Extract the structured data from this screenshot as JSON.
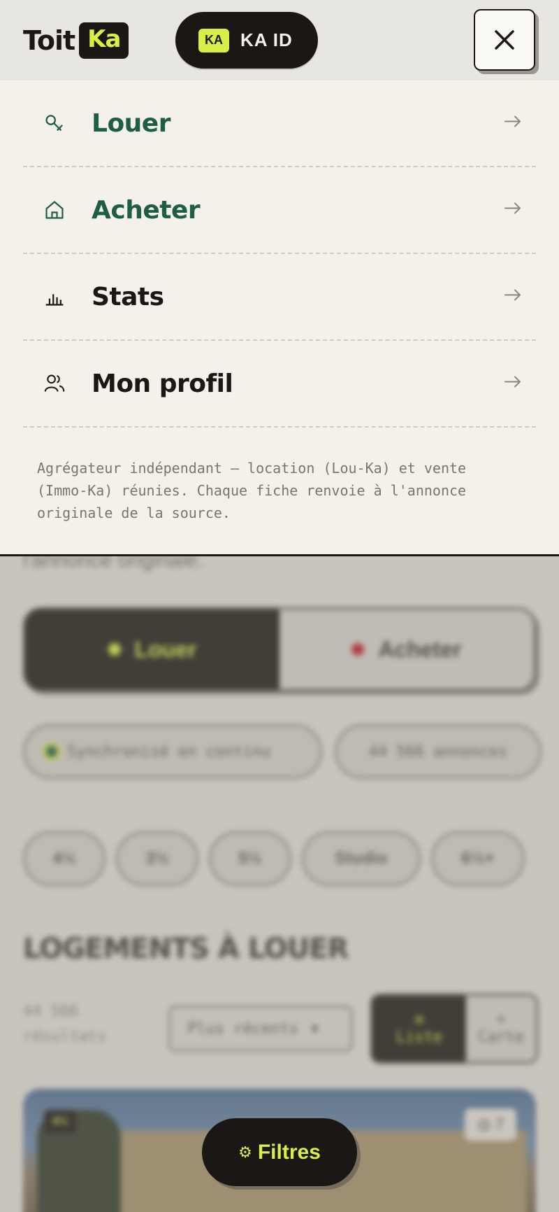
{
  "header": {
    "logo_text": "Toit",
    "logo_badge": "Ka",
    "kaid_badge": "KA",
    "kaid_label": "KA ID",
    "close_icon": "close-icon"
  },
  "menu": {
    "items": [
      {
        "label": "Louer",
        "icon": "key-icon",
        "color": "#1f5e44"
      },
      {
        "label": "Acheter",
        "icon": "house-icon",
        "color": "#1f5e44"
      },
      {
        "label": "Stats",
        "icon": "bar-chart-icon",
        "color": "#1a1714"
      },
      {
        "label": "Mon profil",
        "icon": "users-icon",
        "color": "#1a1714"
      }
    ],
    "note": "Agrégateur indépendant — location (Lou-Ka) et vente (Immo-Ka) réunies. Chaque fiche renvoie à l'annonce originale de la source."
  },
  "background": {
    "fragment": "l'annonce originale.",
    "toggle": {
      "louer": "Louer",
      "acheter": "Acheter"
    },
    "sync_status": "Synchronisé en continu",
    "listing_count": "44 566 annonces",
    "chips": [
      "4½",
      "3½",
      "5½",
      "Studio",
      "6½+"
    ],
    "section_title": "LOGEMENTS À LOUER",
    "results": "44 566 résultats",
    "sort_label": "Plus récents",
    "view_liste": "Liste",
    "view_carte": "Carte",
    "card_badge": "4½",
    "card_photos": "7"
  },
  "filters_button": "Filtres",
  "colors": {
    "accent_lime": "#d8ef4a",
    "ink": "#1a1714",
    "green": "#1f5e44",
    "paper": "#f4f1ea",
    "sync_dot": "#1f5e44",
    "acheter_dot": "#c0182a"
  }
}
